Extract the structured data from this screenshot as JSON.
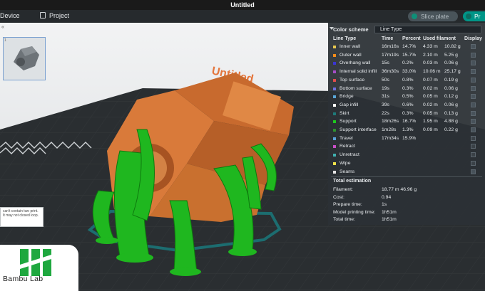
{
  "window": {
    "title": "Untitled"
  },
  "toolbar": {
    "device_label": "Device",
    "project_label": "Project",
    "slice_label": "Slice plate",
    "print_label": "Pr"
  },
  "plate": {
    "thumb_number": "1",
    "watermark": "Untitled",
    "warning_text": "can't contain two print. It may not closed loop."
  },
  "legend": {
    "title": "Color scheme",
    "selected": "Line Type",
    "headers": [
      "Line Type",
      "Time",
      "Percent",
      "Used filament",
      "Display"
    ],
    "rows": [
      {
        "name": "Inner wall",
        "time": "16m16s",
        "percent": "14.7%",
        "length": "4.33 m",
        "weight": "10.82 g",
        "color": "#e8c84f",
        "display": true
      },
      {
        "name": "Outer wall",
        "time": "17m19s",
        "percent": "15.7%",
        "length": "2.10 m",
        "weight": "5.25 g",
        "color": "#f28c1a",
        "display": true
      },
      {
        "name": "Overhang wall",
        "time": "15s",
        "percent": "0.2%",
        "length": "0.03 m",
        "weight": "0.06 g",
        "color": "#3b35d6",
        "display": true
      },
      {
        "name": "Internal solid infill",
        "time": "36m30s",
        "percent": "33.0%",
        "length": "10.06 m",
        "weight": "25.17 g",
        "color": "#a64ec9",
        "display": true
      },
      {
        "name": "Top surface",
        "time": "50s",
        "percent": "0.8%",
        "length": "0.07 m",
        "weight": "0.19 g",
        "color": "#e34c4c",
        "display": true
      },
      {
        "name": "Bottom surface",
        "time": "19s",
        "percent": "0.3%",
        "length": "0.02 m",
        "weight": "0.06 g",
        "color": "#6f6fe0",
        "display": true
      },
      {
        "name": "Bridge",
        "time": "31s",
        "percent": "0.5%",
        "length": "0.05 m",
        "weight": "0.12 g",
        "color": "#5aa7d8",
        "display": true
      },
      {
        "name": "Gap infill",
        "time": "39s",
        "percent": "0.6%",
        "length": "0.02 m",
        "weight": "0.06 g",
        "color": "#ffffff",
        "display": true
      },
      {
        "name": "Skirt",
        "time": "22s",
        "percent": "0.3%",
        "length": "0.05 m",
        "weight": "0.13 g",
        "color": "#1e7a7a",
        "display": true
      },
      {
        "name": "Support",
        "time": "18m26s",
        "percent": "16.7%",
        "length": "1.95 m",
        "weight": "4.88 g",
        "color": "#1ec81e",
        "display": true
      },
      {
        "name": "Support interface",
        "time": "1m28s",
        "percent": "1.3%",
        "length": "0.09 m",
        "weight": "0.22 g",
        "color": "#2f8f2f",
        "display": true
      },
      {
        "name": "Travel",
        "time": "17m34s",
        "percent": "15.9%",
        "length": "",
        "weight": "",
        "color": "#5aa1d8",
        "display": false
      },
      {
        "name": "Retract",
        "time": "",
        "percent": "",
        "length": "",
        "weight": "",
        "color": "#c84fc8",
        "display": false
      },
      {
        "name": "Unretract",
        "time": "",
        "percent": "",
        "length": "",
        "weight": "",
        "color": "#3fb0b0",
        "display": false
      },
      {
        "name": "Wipe",
        "time": "",
        "percent": "",
        "length": "",
        "weight": "",
        "color": "#f0e14a",
        "display": false
      },
      {
        "name": "Seams",
        "time": "",
        "percent": "",
        "length": "",
        "weight": "",
        "color": "#e6e6e6",
        "display": true
      }
    ],
    "estimation_title": "Total estimation",
    "estimation": [
      {
        "label": "Filament:",
        "value": "18.77 m    46.96 g"
      },
      {
        "label": "Cost:",
        "value": "0.94"
      },
      {
        "label": "Prepare time:",
        "value": "1s"
      },
      {
        "label": "Model printing time:",
        "value": "1h51m"
      },
      {
        "label": "Total time:",
        "value": "1h51m"
      }
    ]
  },
  "brand": {
    "name": "Bambu Lab"
  }
}
